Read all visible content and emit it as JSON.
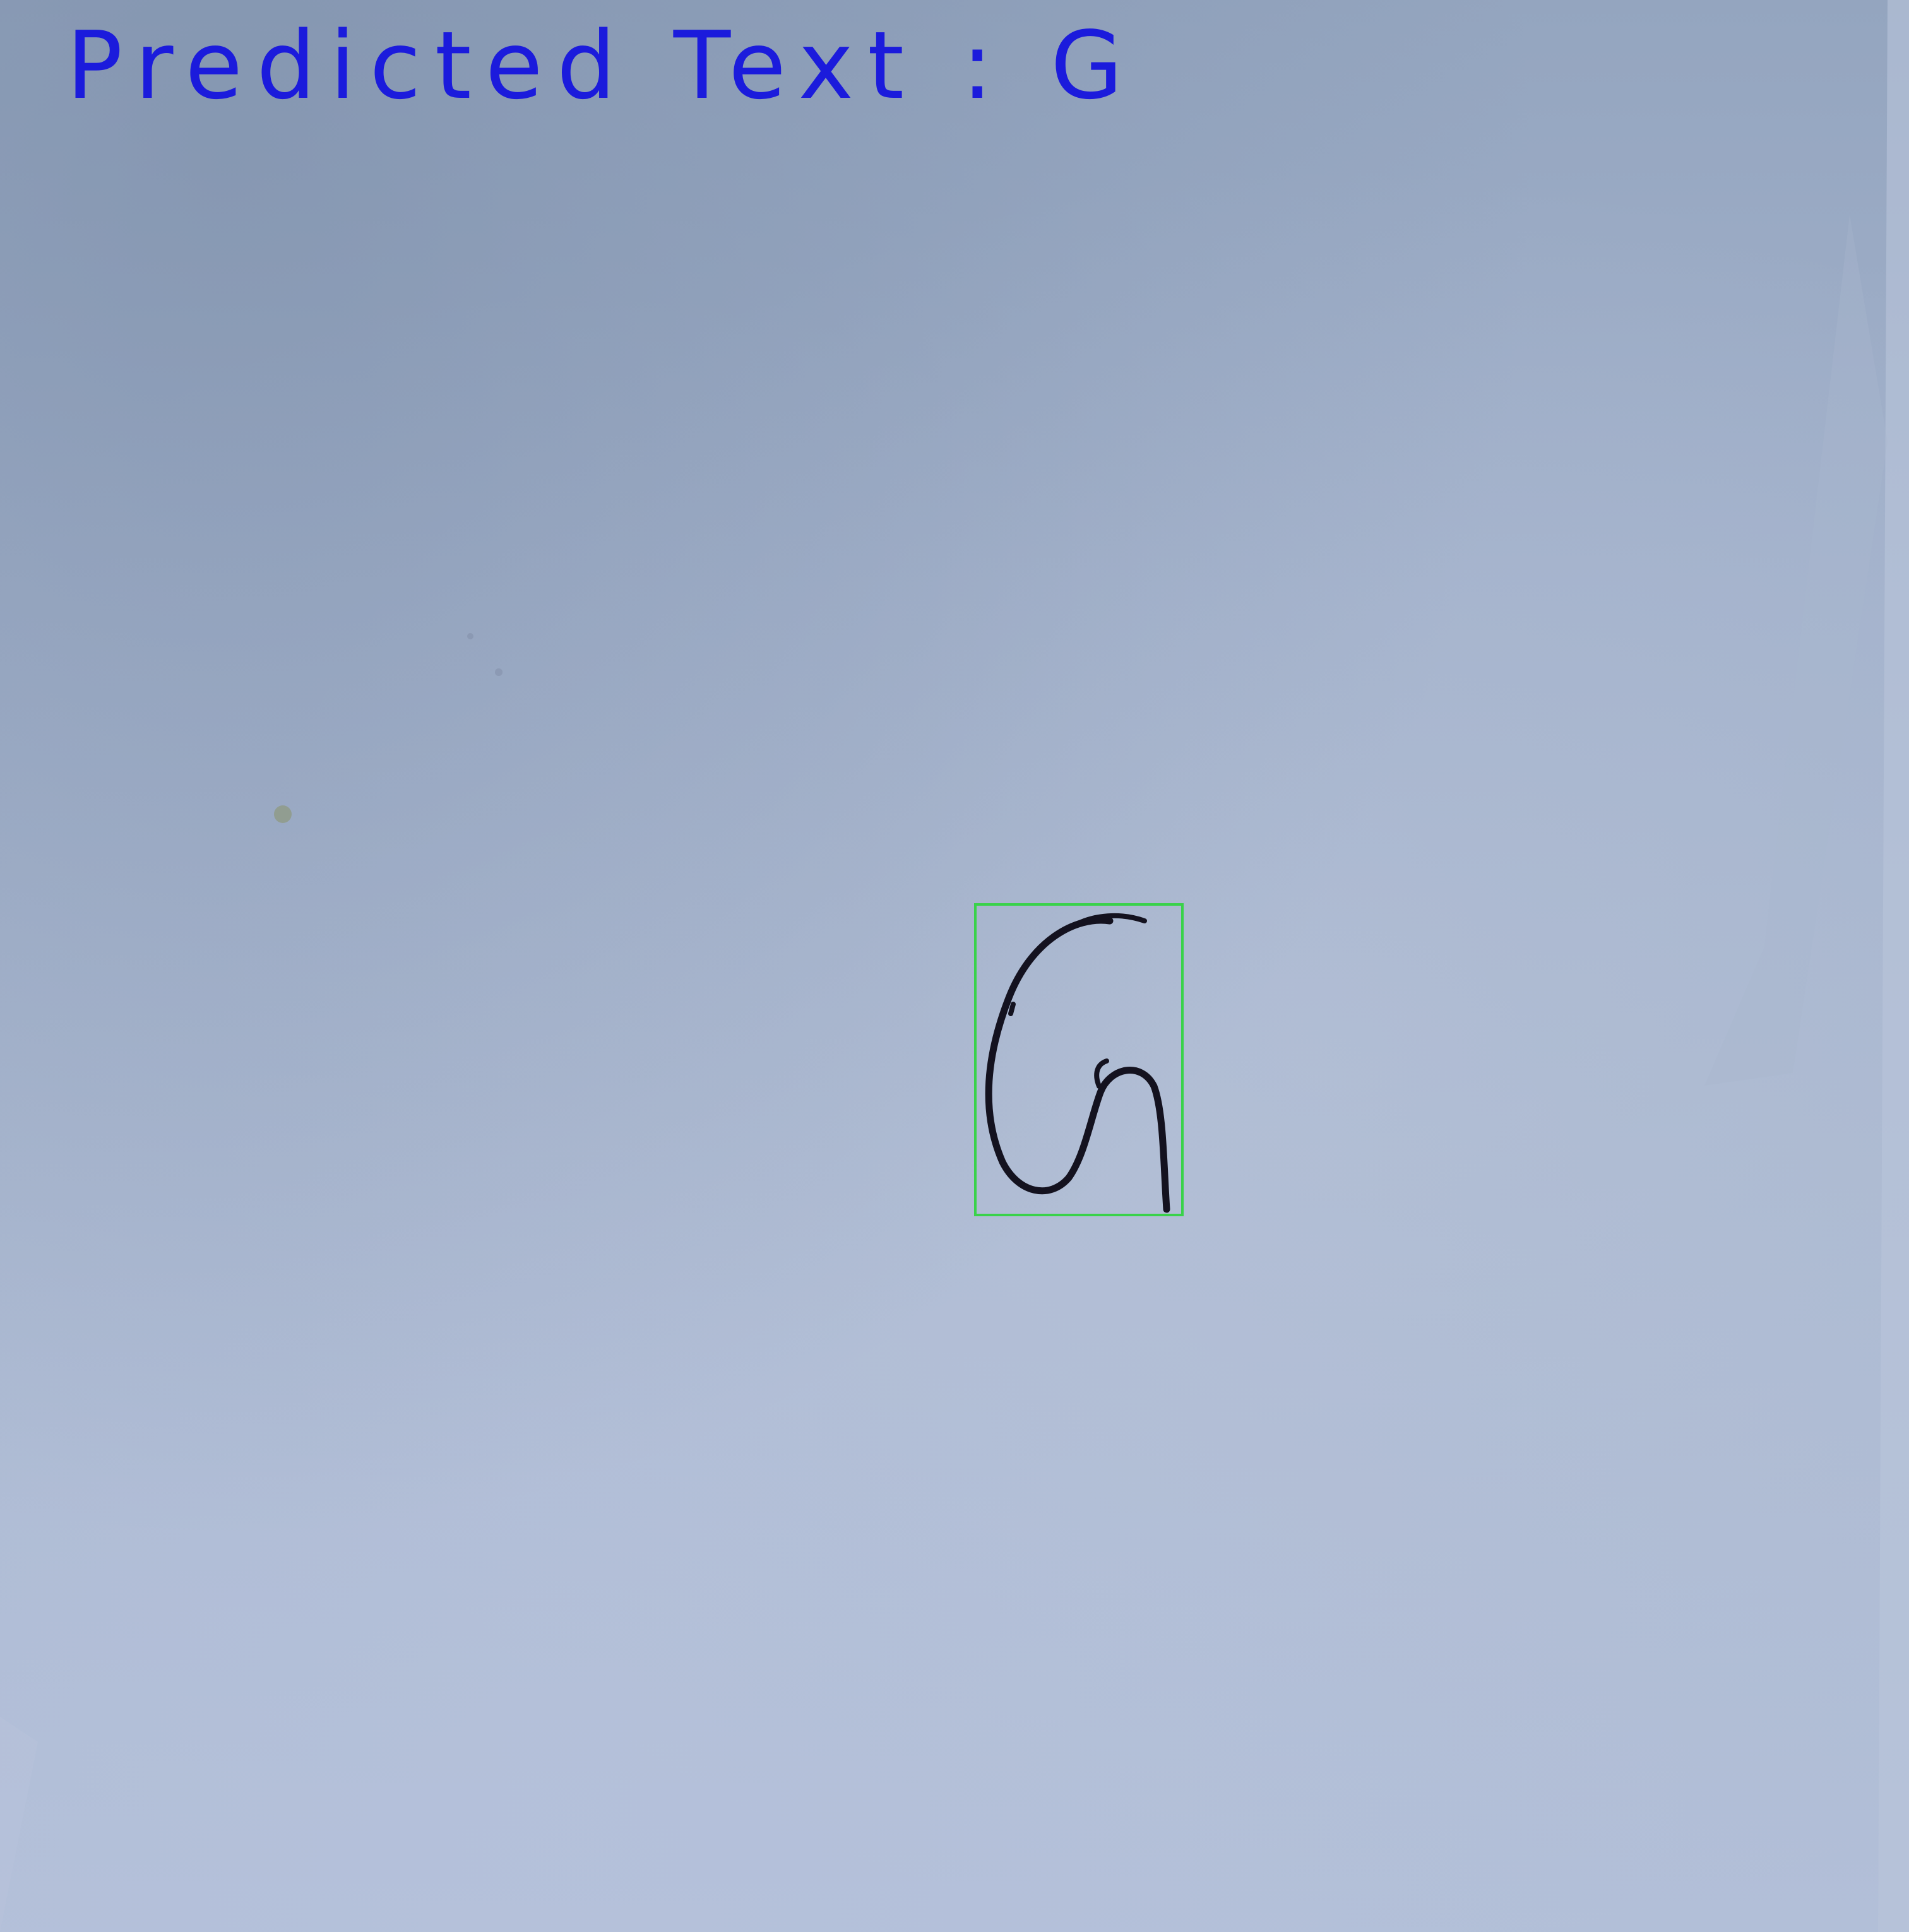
{
  "prediction": {
    "label_text": "Predicted Text : G",
    "label_color": "#1b1bdc"
  },
  "detection": {
    "box_color": "#39d24a",
    "character_ink_color": "#14121f",
    "glyph_description": "G"
  },
  "background": {
    "surface_color": "#a6b4cd"
  }
}
